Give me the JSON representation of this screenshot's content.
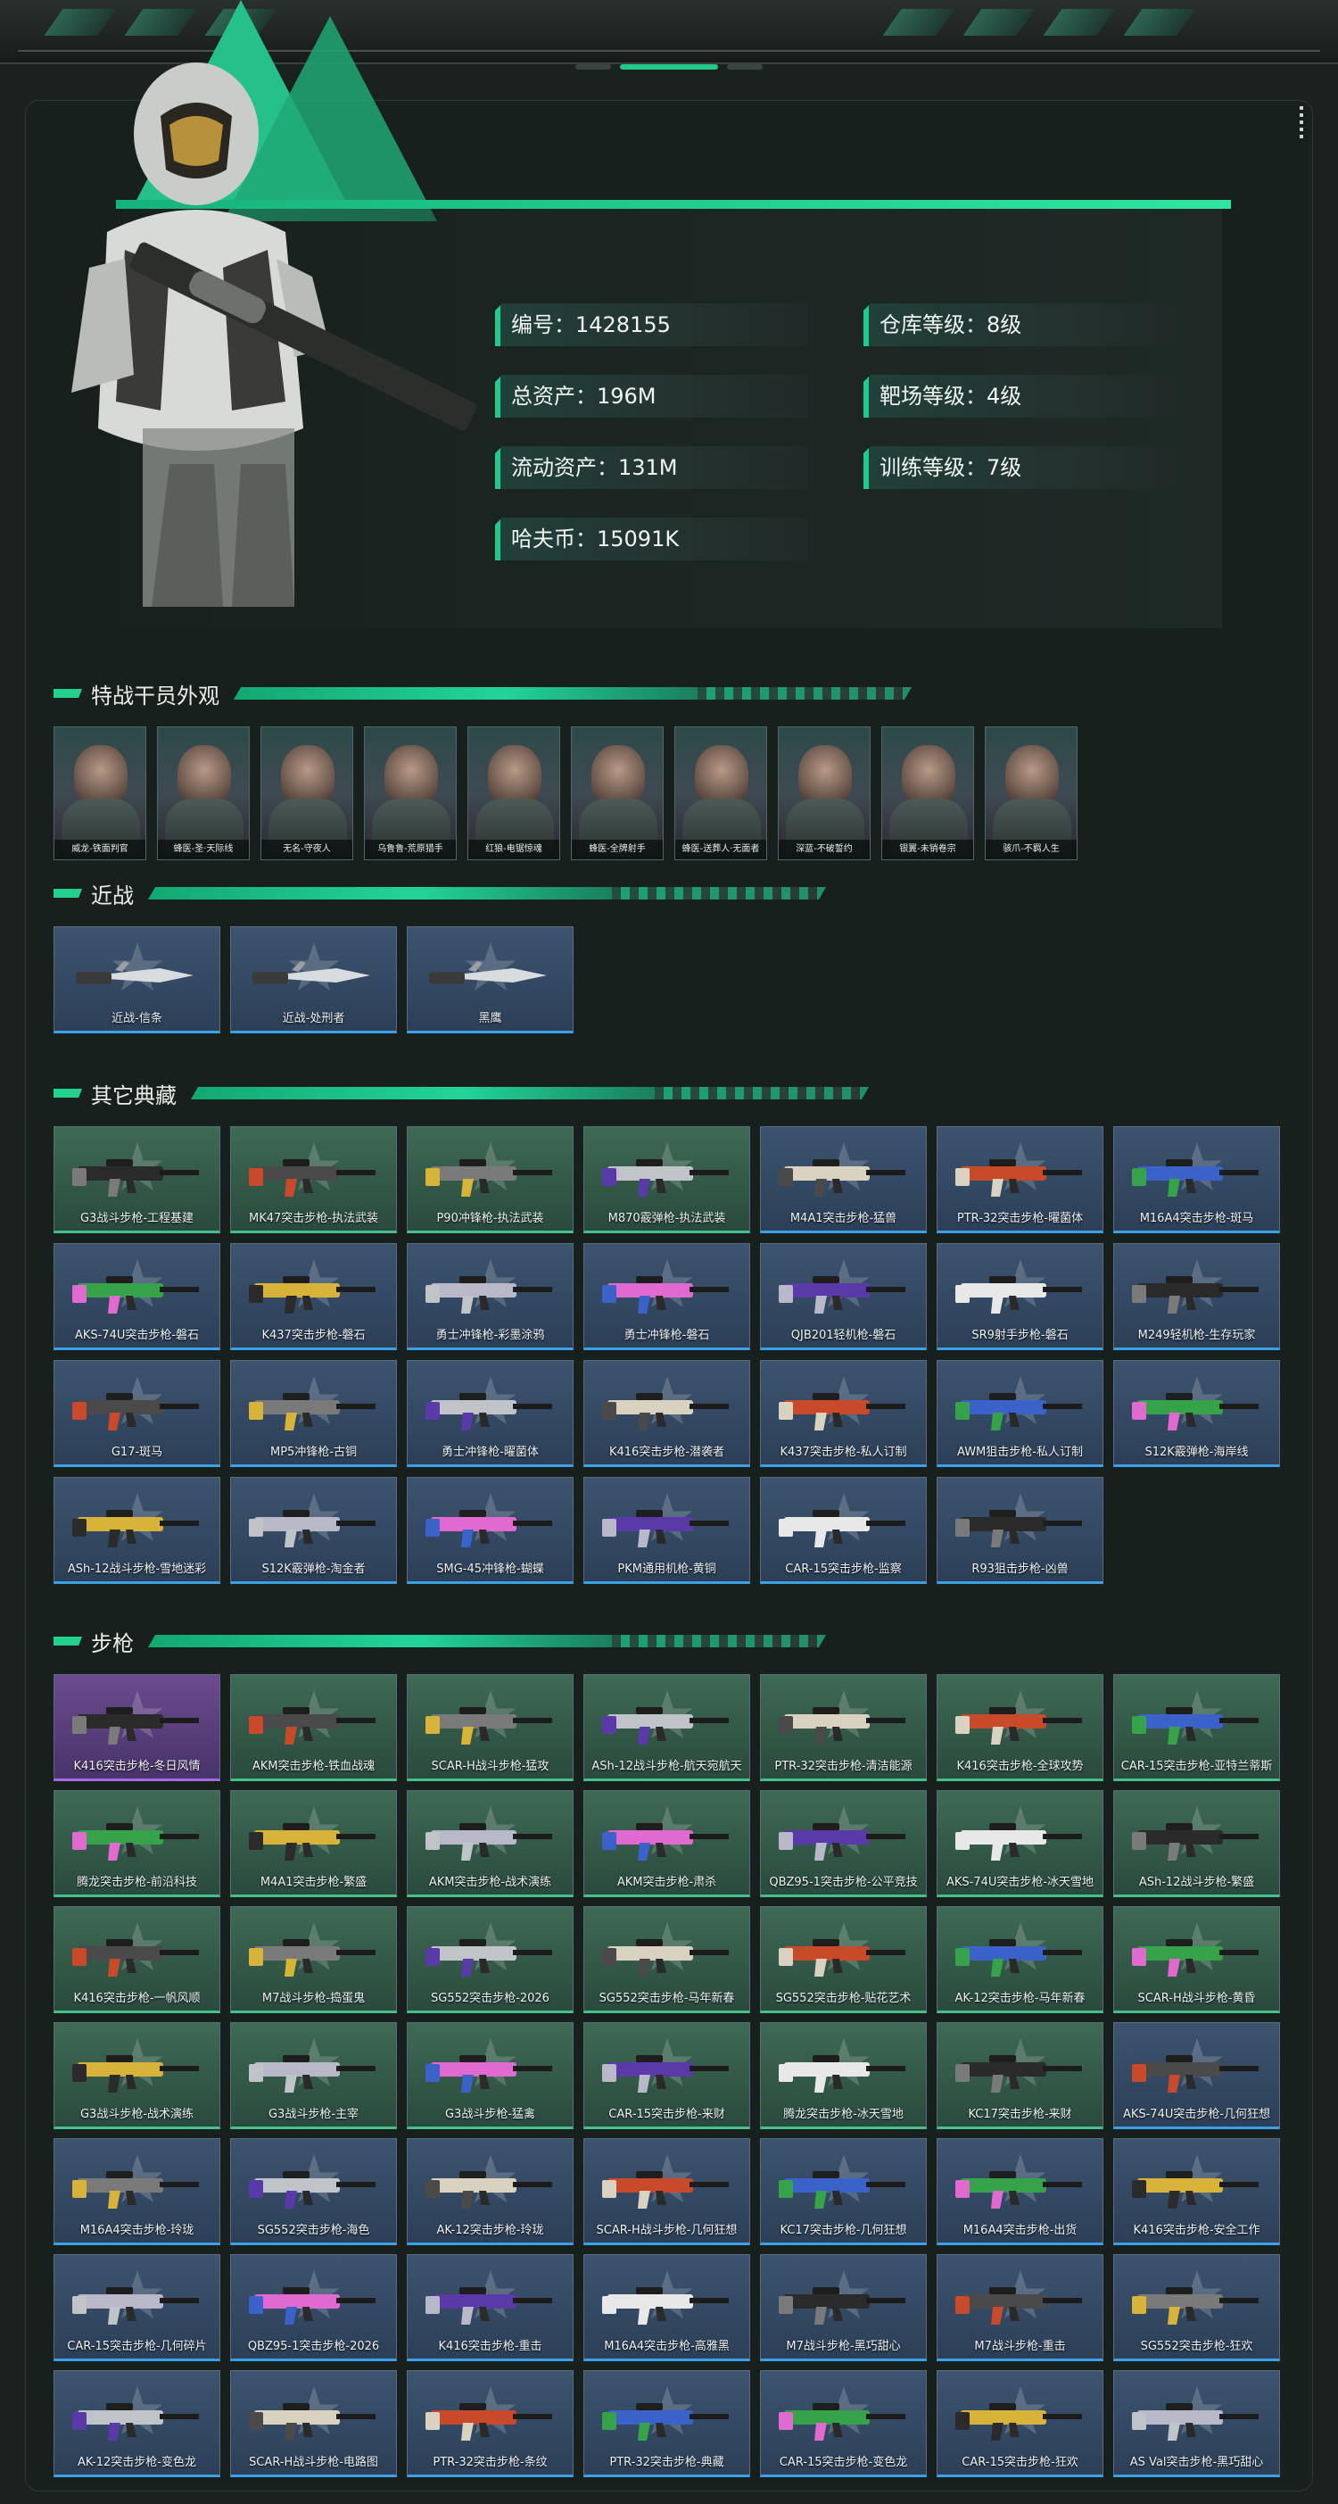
{
  "stats": {
    "id": "编号：1428155",
    "assets": "总资产：196M",
    "liquid": "流动资产：131M",
    "coins": "哈夫币：15091K",
    "warehouse": "仓库等级：8级",
    "range": "靶场等级：4级",
    "training": "训练等级：7级"
  },
  "sections": {
    "agents": "特战干员外观",
    "melee": "近战",
    "other": "其它典藏",
    "rifles": "步枪"
  },
  "agents": [
    "威龙-铁面判官",
    "蜂医-圣·天际线",
    "无名-守夜人",
    "乌鲁鲁-荒原猎手",
    "红狼-电锯惊魂",
    "蜂医-全牌射手",
    "蜂医-送葬人·无面者",
    "深蓝-不破誓约",
    "银翼-未销卷宗",
    "骇爪-不羁人生"
  ],
  "melee": [
    "近战-信条",
    "近战-处刑者",
    "黑鹰"
  ],
  "other": [
    "G3战斗步枪-工程基建",
    "MK47突击步枪-执法武装",
    "P90冲锋枪-执法武装",
    "M870霰弹枪-执法武装",
    "M4A1突击步枪-猛兽",
    "PTR-32突击步枪-曜菌体",
    "M16A4突击步枪-斑马",
    "AKS-74U突击步枪-磐石",
    "K437突击步枪-磐石",
    "勇士冲锋枪-彩墨涂鸦",
    "勇士冲锋枪-磐石",
    "QJB201轻机枪-磐石",
    "SR9射手步枪-磐石",
    "M249轻机枪-生存玩家",
    "G17-斑马",
    "MP5冲锋枪-古铜",
    "勇士冲锋枪-曜菌体",
    "K416突击步枪-潜袭者",
    "K437突击步枪-私人订制",
    "AWM狙击步枪-私人订制",
    "S12K霰弹枪-海岸线",
    "ASh-12战斗步枪-雪地迷彩",
    "S12K霰弹枪-淘金者",
    "SMG-45冲锋枪-蝴蝶",
    "PKM通用机枪-黄铜",
    "CAR-15突击步枪-监察",
    "R93狙击步枪-凶兽"
  ],
  "rifles": [
    "K416突击步枪-冬日风情",
    "AKM突击步枪-铁血战魂",
    "SCAR-H战斗步枪-猛攻",
    "ASh-12战斗步枪-航天宛航天",
    "PTR-32突击步枪-清洁能源",
    "K416突击步枪-全球攻势",
    "CAR-15突击步枪-亚特兰蒂斯",
    "腾龙突击步枪-前沿科技",
    "M4A1突击步枪-繁盛",
    "AKM突击步枪-战术演练",
    "AKM突击步枪-肃杀",
    "QBZ95-1突击步枪-公平竞技",
    "AKS-74U突击步枪-冰天雪地",
    "ASh-12战斗步枪-繁盛",
    "K416突击步枪-一帆风顺",
    "M7战斗步枪-捣蛋鬼",
    "SG552突击步枪-2026",
    "SG552突击步枪-马年新春",
    "SG552突击步枪-贴花艺术",
    "AK-12突击步枪-马年新春",
    "SCAR-H战斗步枪-黄昏",
    "G3战斗步枪-战术演练",
    "G3战斗步枪-主宰",
    "G3战斗步枪-猛禽",
    "CAR-15突击步枪-来财",
    "腾龙突击步枪-冰天雪地",
    "KC17突击步枪-来财",
    "AKS-74U突击步枪-几何狂想",
    "M16A4突击步枪-玲珑",
    "SG552突击步枪-海色",
    "AK-12突击步枪-玲珑",
    "SCAR-H战斗步枪-几何狂想",
    "KC17突击步枪-几何狂想",
    "M16A4突击步枪-出货",
    "K416突击步枪-安全工作",
    "CAR-15突击步枪-几何碎片",
    "QBZ95-1突击步枪-2026",
    "K416突击步枪-重击",
    "M16A4突击步枪-高雅黑",
    "M7战斗步枪-黑巧甜心",
    "M7战斗步枪-重击",
    "SG552突击步枪-狂欢",
    "AK-12突击步枪-变色龙",
    "SCAR-H战斗步枪-电路图",
    "PTR-32突击步枪-条纹",
    "PTR-32突击步枪-典藏",
    "CAR-15突击步枪-变色龙",
    "CAR-15突击步枪-狂欢",
    "AS Val突击步枪-黑巧甜心"
  ],
  "colors": {
    "accent": "#22d18e",
    "bg": "#1b211f",
    "card_blue": "#34495f",
    "card_green": "#355a49",
    "card_purple": "#5a3f7c"
  }
}
